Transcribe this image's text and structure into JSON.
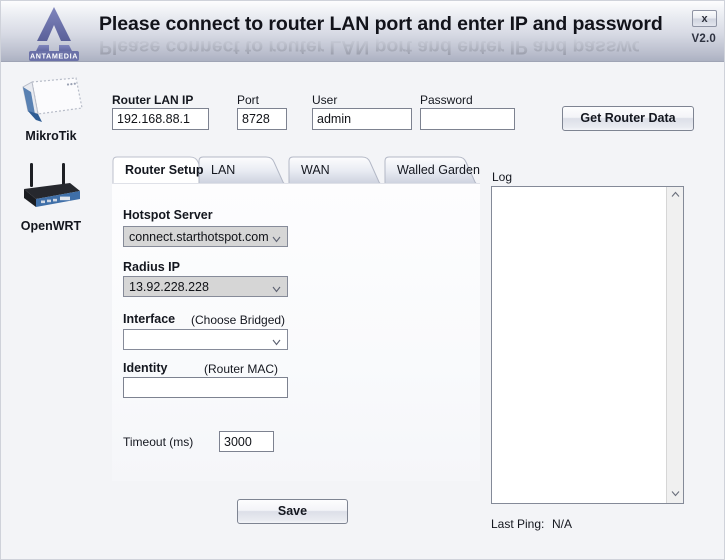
{
  "window": {
    "title": "Please connect to router LAN port and enter IP and password",
    "version": "V2.0",
    "close_label": "x"
  },
  "brand": {
    "logo_text": "ANTAMEDIA",
    "accent_color": "#6e74ad"
  },
  "sidebar": {
    "devices": [
      {
        "label": "MikroTik",
        "icon": "router-white-icon"
      },
      {
        "label": "OpenWRT",
        "icon": "router-black-antenna-icon"
      }
    ]
  },
  "connection": {
    "lan_ip": {
      "label": "Router LAN IP",
      "value": "192.168.88.1",
      "placeholder": ""
    },
    "port": {
      "label": "Port",
      "value": "8728",
      "placeholder": ""
    },
    "user": {
      "label": "User",
      "value": "admin",
      "placeholder": ""
    },
    "password": {
      "label": "Password",
      "value": "",
      "placeholder": ""
    },
    "get_router_data_label": "Get Router Data"
  },
  "tabs": [
    {
      "label": "Router Setup",
      "active": true
    },
    {
      "label": "LAN",
      "active": false
    },
    {
      "label": "WAN",
      "active": false
    },
    {
      "label": "Walled Garden",
      "active": false
    }
  ],
  "router_setup": {
    "hotspot_server": {
      "label": "Hotspot Server",
      "value": "connect.starthotspot.com"
    },
    "radius_ip": {
      "label": "Radius IP",
      "value": "13.92.228.228"
    },
    "interface": {
      "label": "Interface",
      "hint": "(Choose Bridged)",
      "value": ""
    },
    "identity": {
      "label": "Identity",
      "hint": "(Router MAC)",
      "value": "",
      "placeholder": ""
    },
    "timeout": {
      "label": "Timeout (ms)",
      "value": "3000",
      "placeholder": ""
    },
    "save_label": "Save"
  },
  "log": {
    "label": "Log",
    "content": "",
    "last_ping_label": "Last Ping:",
    "last_ping_value": "N/A"
  }
}
